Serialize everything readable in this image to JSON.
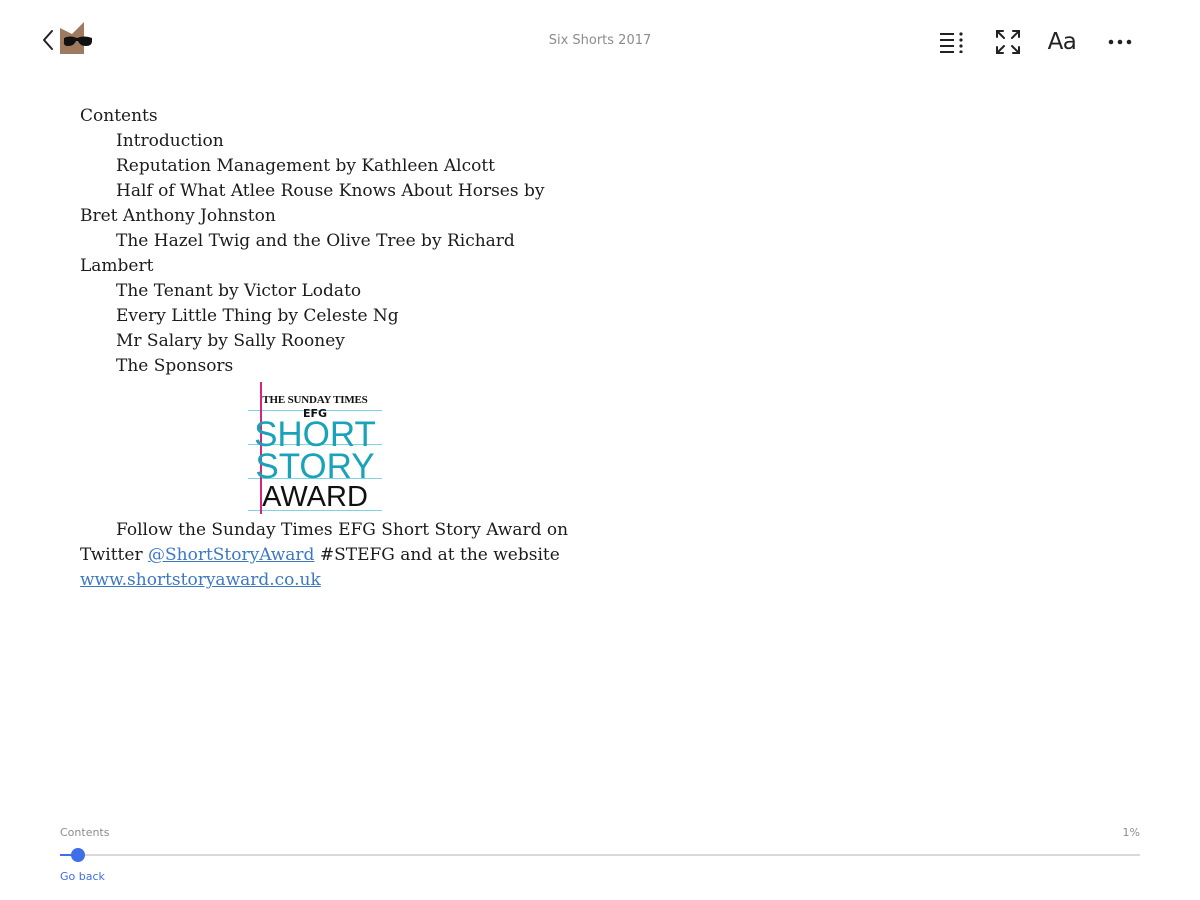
{
  "header": {
    "book_title": "Six Shorts 2017",
    "back_icon": "chevron-left-icon",
    "logo_icon": "bookmate-logo-icon",
    "toc_icon": "table-of-contents-icon",
    "fullscreen_icon": "fullscreen-icon",
    "font_label": "Aa",
    "more_icon": "more-dots-icon"
  },
  "content": {
    "heading": "Contents",
    "entries": [
      "Introduction",
      "Reputation Management by Kathleen Alcott",
      "Half of What Atlee Rouse Knows About Horses by Bret Anthony Johnston",
      "The Hazel Twig and the Olive Tree by Richard Lambert",
      "The Tenant by Victor Lodato",
      "Every Little Thing by Celeste Ng",
      "Mr Salary by Sally Rooney",
      "The Sponsors"
    ],
    "award_logo": {
      "line1": "THE SUNDAY TIMES",
      "line2": "EFG",
      "line3": "SHORT",
      "line4": "STORY",
      "line5": "AWARD"
    },
    "follow_text": "Follow the Sunday Times EFG Short Story Award on Twitter",
    "twitter_link": "@ShortStoryAward",
    "after_link_text": "#STEFG and at the website",
    "website_link": "www.shortstoryaward.co.uk"
  },
  "progress": {
    "chapter": "Contents",
    "percent_label": "1%",
    "fraction": 0.017,
    "go_back": "Go back"
  },
  "colors": {
    "accent": "#3f6ee8",
    "link": "#3b78c5",
    "muted_text": "#8c8c8c",
    "logo_brown": "#a07a5e",
    "award_teal": "#1aa3b8",
    "award_magenta": "#d6257a"
  }
}
